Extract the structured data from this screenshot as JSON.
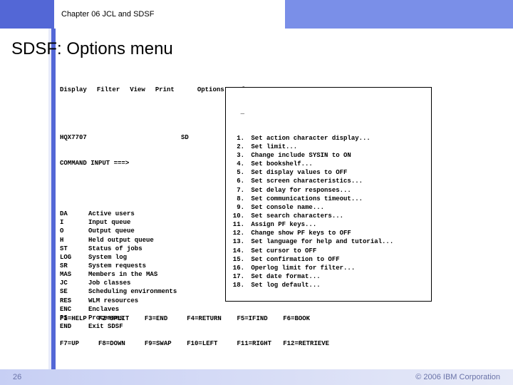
{
  "header": {
    "chapter": "Chapter 06 JCL and SDSF"
  },
  "slide": {
    "title": "SDSF: Options menu"
  },
  "menubar": [
    "Display",
    "Filter",
    "View",
    "Print",
    "Options",
    "Help"
  ],
  "session": {
    "id": "HQX7707",
    "short": "SD",
    "prompt": "COMMAND INPUT ===>"
  },
  "commands": [
    {
      "k": "DA",
      "v": "Active users"
    },
    {
      "k": "I",
      "v": "Input queue"
    },
    {
      "k": "O",
      "v": "Output queue"
    },
    {
      "k": "H",
      "v": "Held output queue"
    },
    {
      "k": "ST",
      "v": "Status of jobs"
    },
    {
      "k": "",
      "v": ""
    },
    {
      "k": "LOG",
      "v": "System log"
    },
    {
      "k": "SR",
      "v": "System requests"
    },
    {
      "k": "MAS",
      "v": "Members in the MAS"
    },
    {
      "k": "JC",
      "v": "Job classes"
    },
    {
      "k": "SE",
      "v": "Scheduling environments"
    },
    {
      "k": "RES",
      "v": "WLM resources"
    },
    {
      "k": "ENC",
      "v": "Enclaves"
    },
    {
      "k": "PS",
      "v": "Processes"
    },
    {
      "k": "",
      "v": ""
    },
    {
      "k": "END",
      "v": "Exit SDSF"
    }
  ],
  "optionsMenu": {
    "entry_prefix": "_",
    "items": [
      "Set action character display...",
      "Set limit...",
      "Change include SYSIN to ON",
      "Set bookshelf...",
      "Set display values to OFF",
      "Set screen characteristics...",
      "Set delay for responses...",
      "Set communications timeout...",
      "Set console name...",
      "Set search characters...",
      "Assign PF keys...",
      "Change show PF keys to OFF",
      "Set language for help and tutorial...",
      "Set cursor to OFF",
      "Set confirmation to OFF",
      "Operlog limit for filter...",
      "Set date format...",
      "Set log default..."
    ]
  },
  "fkeys": {
    "row1": [
      {
        "l": "F1=HELP"
      },
      {
        "l": "F2=SPLIT"
      },
      {
        "l": "F3=END"
      },
      {
        "l": "F4=RETURN"
      },
      {
        "l": "F5=IFIND"
      },
      {
        "l": "F6=BOOK"
      }
    ],
    "row2": [
      {
        "l": "F7=UP"
      },
      {
        "l": "F8=DOWN"
      },
      {
        "l": "F9=SWAP"
      },
      {
        "l": "F10=LEFT"
      },
      {
        "l": "F11=RIGHT"
      },
      {
        "l": "F12=RETRIEVE"
      }
    ]
  },
  "footer": {
    "page": "26",
    "copyright": "© 2006 IBM Corporation"
  }
}
